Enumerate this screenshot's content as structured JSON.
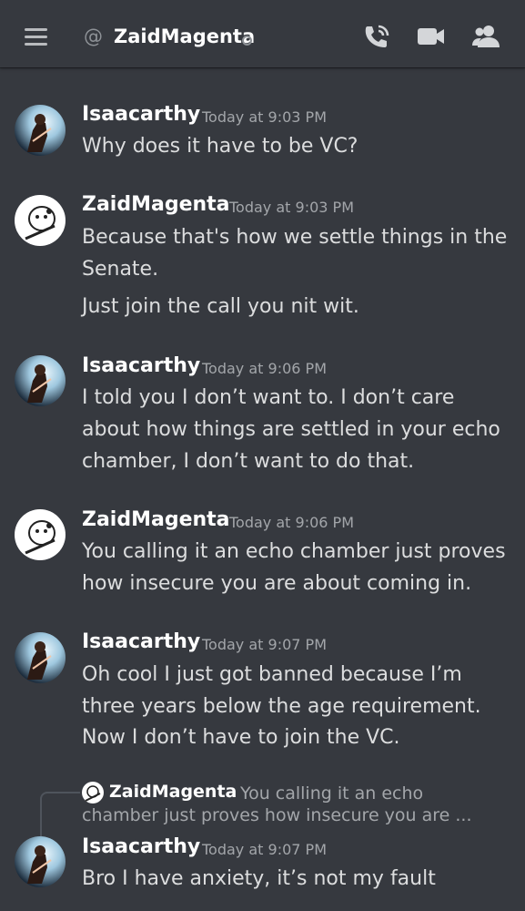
{
  "header": {
    "at_symbol": "@",
    "channel_name": "ZaidMagenta",
    "icons": [
      "menu-icon",
      "call-icon",
      "video-icon",
      "members-icon"
    ]
  },
  "messages": [
    {
      "author": "Isaacarthy",
      "time": "Today at 9:03 PM",
      "lines": [
        "Why does it have to be VC?"
      ]
    },
    {
      "author": "ZaidMagenta",
      "time": "Today at 9:03 PM",
      "lines": [
        "Because that's how we settle things in the",
        "Senate.",
        "Just join the call you nit wit."
      ]
    },
    {
      "author": "Isaacarthy",
      "time": "Today at 9:06 PM",
      "lines": [
        "I told you I don’t want to. I don’t care",
        "about how things are settled in your echo",
        "chamber, I don’t want to do that."
      ]
    },
    {
      "author": "ZaidMagenta",
      "time": "Today at 9:06 PM",
      "lines": [
        "You calling it an echo chamber just proves",
        "how insecure you are about coming in."
      ]
    },
    {
      "author": "Isaacarthy",
      "time": "Today at 9:07 PM",
      "lines": [
        "Oh cool I just got banned because I’m",
        "three years below the age requirement.",
        "Now I don’t have to join the VC."
      ]
    },
    {
      "author": "Isaacarthy",
      "time": "Today at 9:07 PM",
      "lines": [
        "Bro I have anxiety, it’s not my fault"
      ]
    }
  ],
  "reply_preview": {
    "author": "ZaidMagenta",
    "text_line1": "You calling it an echo",
    "text_line2": "chamber just proves how insecure you are ..."
  },
  "colors": {
    "background": "#36393f",
    "username": "#ffffff",
    "text": "#dcddde",
    "muted": "#a3a6aa"
  }
}
